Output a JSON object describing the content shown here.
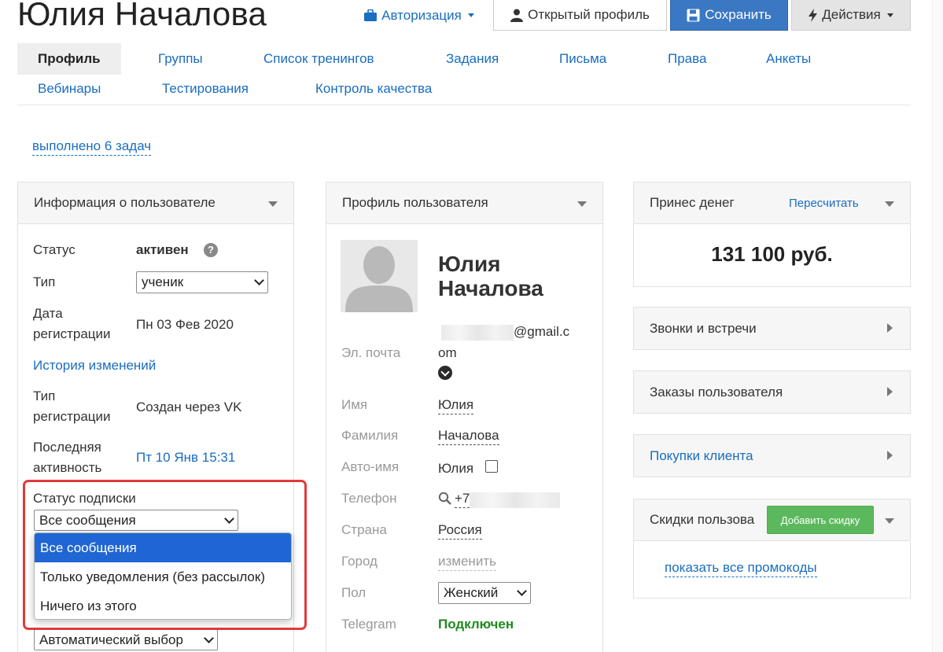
{
  "page_title": "Юлия Началова",
  "header_buttons": {
    "auth": "Авторизация",
    "open_profile": "Открытый профиль",
    "save": "Сохранить",
    "actions": "Действия"
  },
  "tabs": [
    "Профиль",
    "Группы",
    "Список тренингов",
    "Задания",
    "Письма",
    "Права",
    "Анкеты",
    "Вебинары",
    "Тестирования",
    "Контроль качества"
  ],
  "tasks_link": "выполнено 6 задач",
  "user_info": {
    "title": "Информация о пользователе",
    "status_label": "Статус",
    "status_value": "активен",
    "type_label": "Тип",
    "type_value": "ученик",
    "reg_date_label_1": "Дата",
    "reg_date_label_2": "регистрации",
    "reg_date_value": "Пн 03 Фев 2020",
    "history_link": "История изменений",
    "reg_type_label_1": "Тип",
    "reg_type_label_2": "регистрации",
    "reg_type_value": "Создан через VK",
    "last_activity_label_1": "Последняя",
    "last_activity_label_2": "активность",
    "last_activity_value": "Пт 10 Янв 15:31",
    "subscription_label": "Статус подписки",
    "subscription_value": "Все сообщения",
    "subscription_options": [
      "Все сообщения",
      "Только уведомления (без рассылок)",
      "Ничего из этого"
    ],
    "auto_select_value": "Автоматический выбор"
  },
  "user_profile": {
    "title": "Профиль пользователя",
    "name_line1": "Юлия",
    "name_line2": "Началова",
    "email_label": "Эл. почта",
    "email_value_1": "@gmail.c",
    "email_value_2": "om",
    "first_name_label": "Имя",
    "first_name_value": "Юлия",
    "last_name_label": "Фамилия",
    "last_name_value": "Началова",
    "autoname_label": "Авто-имя",
    "autoname_value": "Юлия",
    "phone_label": "Телефон",
    "phone_value": "+7",
    "country_label": "Страна",
    "country_value": "Россия",
    "city_label": "Город",
    "city_value": "изменить",
    "gender_label": "Пол",
    "gender_value": "Женский",
    "telegram_label": "Telegram",
    "telegram_value": "Подключен"
  },
  "money_panel": {
    "title": "Принес денег",
    "recalc": "Пересчитать",
    "amount": "131 100 руб."
  },
  "calls_panel": "Звонки и встречи",
  "orders_panel": "Заказы пользователя",
  "purchases_panel": "Покупки клиента",
  "discounts_panel": {
    "title": "Скидки пользова",
    "add_button": "Добавить скидку",
    "show_promos": "показать все промокоды"
  },
  "colors": {
    "link": "#1a6dc0",
    "save_button": "#3a78c3",
    "green": "#5cb85c",
    "highlight": "#e03a3a",
    "selected_option": "#1f66d4",
    "telegram_green": "#1e8a1e"
  }
}
